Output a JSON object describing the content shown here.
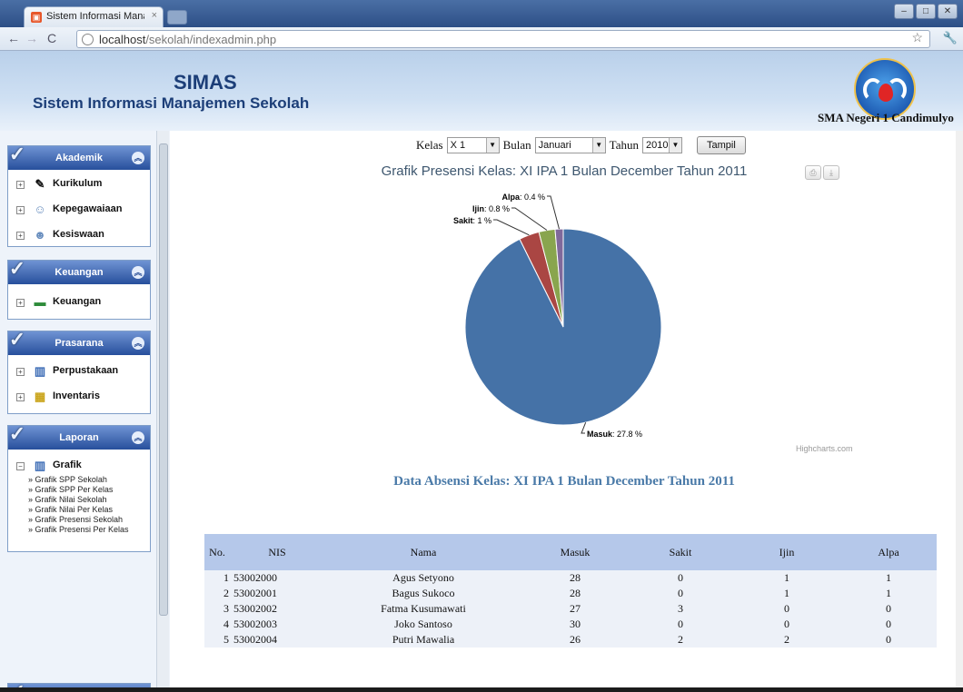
{
  "browser": {
    "tab_title": "Sistem Informasi Manajeme",
    "url_host": "localhost",
    "url_path": "/sekolah/indexadmin.php"
  },
  "header": {
    "app_name": "SIMAS",
    "subtitle": "Sistem Informasi Manajemen Sekolah",
    "school_name": "SMA Negeri 1 Candimulyo"
  },
  "sidebar": {
    "panels": [
      {
        "title": "Akademik",
        "items": [
          "Kurikulum",
          "Kepegawaiaan",
          "Kesiswaan"
        ]
      },
      {
        "title": "Keuangan",
        "items": [
          "Keuangan"
        ]
      },
      {
        "title": "Prasarana",
        "items": [
          "Perpustakaan",
          "Inventaris"
        ]
      },
      {
        "title": "Laporan",
        "items": [
          "Grafik"
        ],
        "sub_items": [
          "» Grafik SPP Sekolah",
          "» Grafik SPP Per Kelas",
          "» Grafik Nilai Sekolah",
          "» Grafik Nilai Per Kelas",
          "» Grafik Presensi Sekolah",
          "» Grafik Presensi Per Kelas"
        ]
      }
    ]
  },
  "filters": {
    "kelas_label": "Kelas",
    "kelas_value": "X 1",
    "bulan_label": "Bulan",
    "bulan_value": "Januari",
    "tahun_label": "Tahun",
    "tahun_value": "2010",
    "submit_label": "Tampil"
  },
  "chart_data": {
    "type": "pie",
    "title": "Grafik Presensi Kelas: XI IPA 1 Bulan December Tahun 2011",
    "slices": [
      {
        "name": "Masuk",
        "value": 27.8,
        "label": "27.8 %",
        "color": "#4572a7"
      },
      {
        "name": "Sakit",
        "value": 1,
        "label": "1 %",
        "color": "#aa4643"
      },
      {
        "name": "Ijin",
        "value": 0.8,
        "label": "0.8 %",
        "color": "#89a54e"
      },
      {
        "name": "Alpa",
        "value": 0.4,
        "label": "0.4 %",
        "color": "#80699b"
      }
    ],
    "credit": "Highcharts.com"
  },
  "table": {
    "title": "Data Absensi Kelas: XI IPA 1 Bulan December Tahun 2011",
    "headers": [
      "No.",
      "NIS",
      "Nama",
      "Masuk",
      "Sakit",
      "Ijin",
      "Alpa"
    ],
    "rows": [
      [
        "1",
        "53002000",
        "Agus Setyono",
        "28",
        "0",
        "1",
        "1"
      ],
      [
        "2",
        "53002001",
        "Bagus Sukoco",
        "28",
        "0",
        "1",
        "1"
      ],
      [
        "3",
        "53002002",
        "Fatma Kusumawati",
        "27",
        "3",
        "0",
        "0"
      ],
      [
        "4",
        "53002003",
        "Joko Santoso",
        "30",
        "0",
        "0",
        "0"
      ],
      [
        "5",
        "53002004",
        "Putri Mawalia",
        "26",
        "2",
        "2",
        "0"
      ]
    ]
  }
}
